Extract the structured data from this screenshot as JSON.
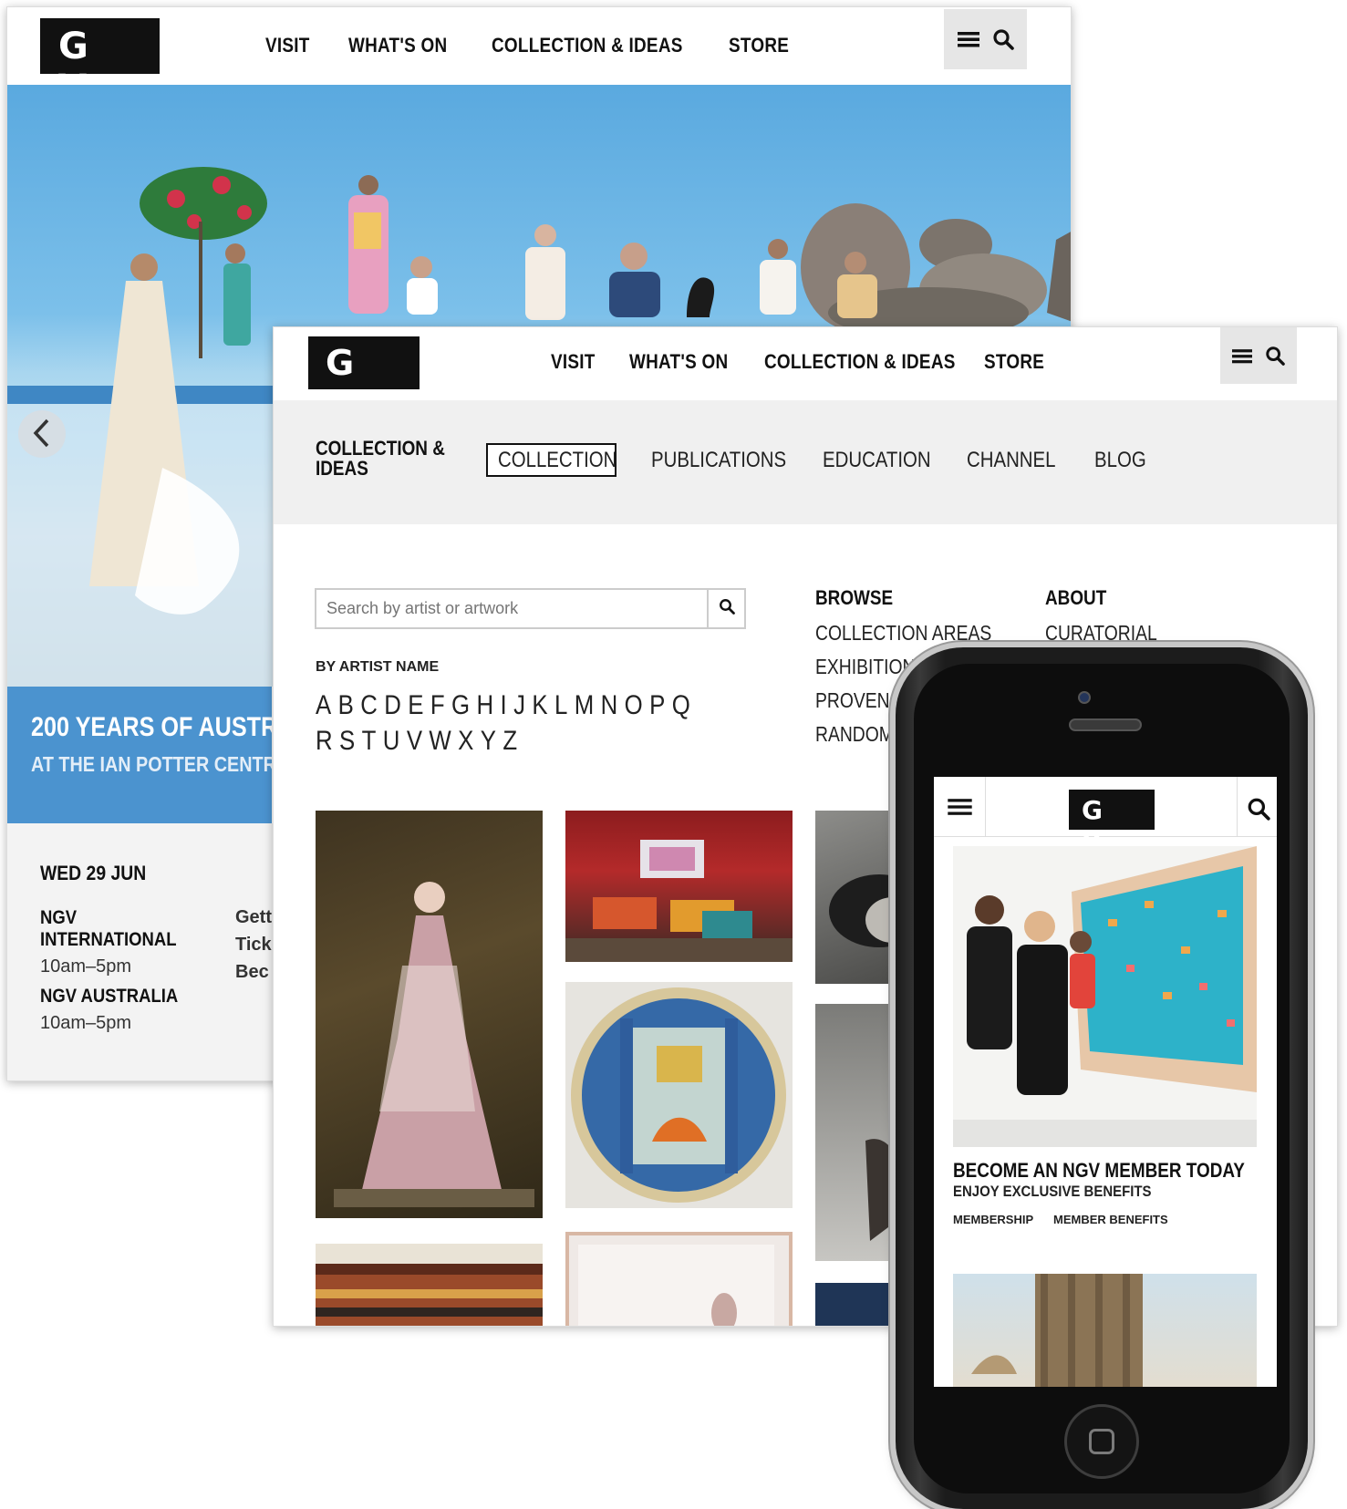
{
  "desktop_home": {
    "logo": "N G V",
    "nav": [
      "VISIT",
      "WHAT'S ON",
      "COLLECTION & IDEAS",
      "STORE"
    ],
    "banner_title": "200 YEARS OF AUSTR",
    "banner_subtitle": "AT THE IAN POTTER CENTR",
    "hours": {
      "date": "WED 29 JUN",
      "venue1_line1": "NGV",
      "venue1_line2": "INTERNATIONAL",
      "venue1_hours": "10am–5pm",
      "venue2": "NGV AUSTRALIA",
      "venue2_hours": "10am–5pm",
      "links": [
        "Gett",
        "Tick",
        "Bec"
      ]
    }
  },
  "desktop_collection": {
    "logo": "N G V",
    "nav": [
      "VISIT",
      "WHAT'S ON",
      "COLLECTION & IDEAS",
      "STORE"
    ],
    "section_title_line1": "COLLECTION &",
    "section_title_line2": "IDEAS",
    "subnav": [
      "COLLECTION",
      "PUBLICATIONS",
      "EDUCATION",
      "CHANNEL",
      "BLOG"
    ],
    "search_placeholder": "Search by artist or artwork",
    "by_artist_label": "BY ARTIST NAME",
    "alphabet_row1": "ABCDEFGHIJKLMNOPQ",
    "alphabet_row2": "RSTUVWXYZ",
    "browse": {
      "heading": "BROWSE",
      "items": [
        "COLLECTION AREAS",
        "EXHIBITION HI",
        "PROVENAN",
        "RANDOM V"
      ]
    },
    "about": {
      "heading": "ABOUT",
      "items": [
        "CURATORIAL"
      ]
    }
  },
  "mobile": {
    "logo": "N G V",
    "promo_title": "BECOME AN NGV MEMBER TODAY",
    "promo_subtitle": "ENJOY EXCLUSIVE BENEFITS",
    "links": [
      "MEMBERSHIP",
      "MEMBER BENEFITS"
    ]
  },
  "colors": {
    "banner_blue": "#4b93cf",
    "logo_black": "#111111",
    "subnav_grey": "#f0f0f0",
    "toolbox_grey": "#e6e6e6"
  }
}
